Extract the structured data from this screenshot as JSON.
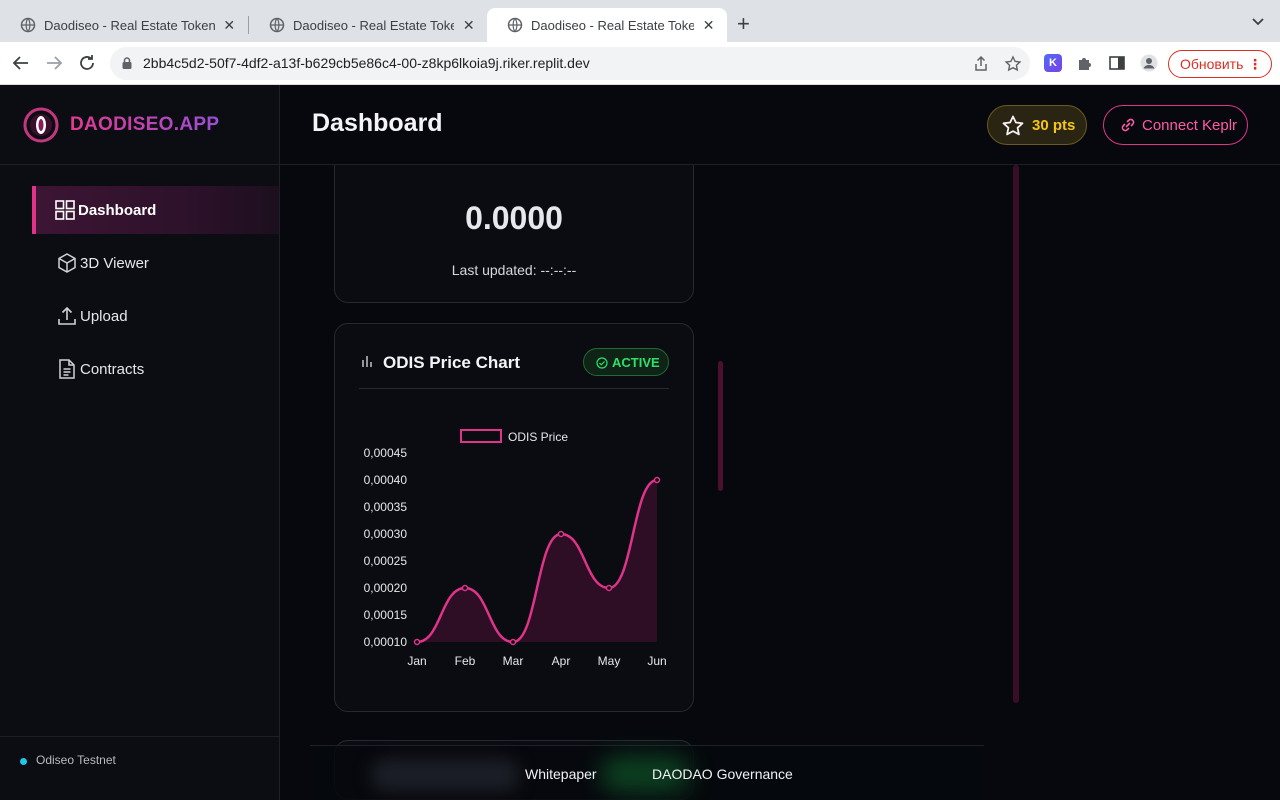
{
  "browser": {
    "tabs": [
      {
        "title": "Daodiseo - Real Estate Tokeniz",
        "active": false
      },
      {
        "title": "Daodiseo - Real Estate Tokeniz",
        "active": false
      },
      {
        "title": "Daodiseo - Real Estate Tokeniz",
        "active": true
      }
    ],
    "url": "2bb4c5d2-50f7-4df2-a13f-b629cb5e86c4-00-z8kp6lkoia9j.riker.replit.dev",
    "update_label": "Обновить",
    "extension_k_label": "K"
  },
  "app": {
    "brand": "DAODISEO.APP",
    "page_title": "Dashboard",
    "points_label": "30 pts",
    "connect_label": "Connect Keplr",
    "nav": [
      {
        "label": "Dashboard",
        "icon": "grid-icon",
        "active": true
      },
      {
        "label": "3D Viewer",
        "icon": "cube-icon",
        "active": false
      },
      {
        "label": "Upload",
        "icon": "upload-icon",
        "active": false
      },
      {
        "label": "Contracts",
        "icon": "document-icon",
        "active": false
      }
    ],
    "network_label": "Odiseo Testnet",
    "price_card": {
      "value": "0.0000",
      "last_updated": "Last updated: --:--:--"
    },
    "chart_card": {
      "title": "ODIS Price Chart",
      "status": "ACTIVE"
    },
    "footer_links": [
      "Whitepaper",
      "DAODAO Governance"
    ]
  },
  "colors": {
    "accent": "#e0338a",
    "status_green": "#2ee06a",
    "points_gold": "#f5c518"
  },
  "chart_data": {
    "type": "line",
    "categories": [
      "Jan",
      "Feb",
      "Mar",
      "Apr",
      "May",
      "Jun"
    ],
    "series": [
      {
        "name": "ODIS Price",
        "values": [
          0.0001,
          0.0002,
          0.0001,
          0.0003,
          0.0002,
          0.0004
        ],
        "color": "#e0338a"
      }
    ],
    "yticks": [
      "0,00010",
      "0,00015",
      "0,00020",
      "0,00025",
      "0,00030",
      "0,00035",
      "0,00040",
      "0,00045"
    ],
    "ylim": [
      0.0001,
      0.00045
    ],
    "legend": "top",
    "fill": true
  }
}
